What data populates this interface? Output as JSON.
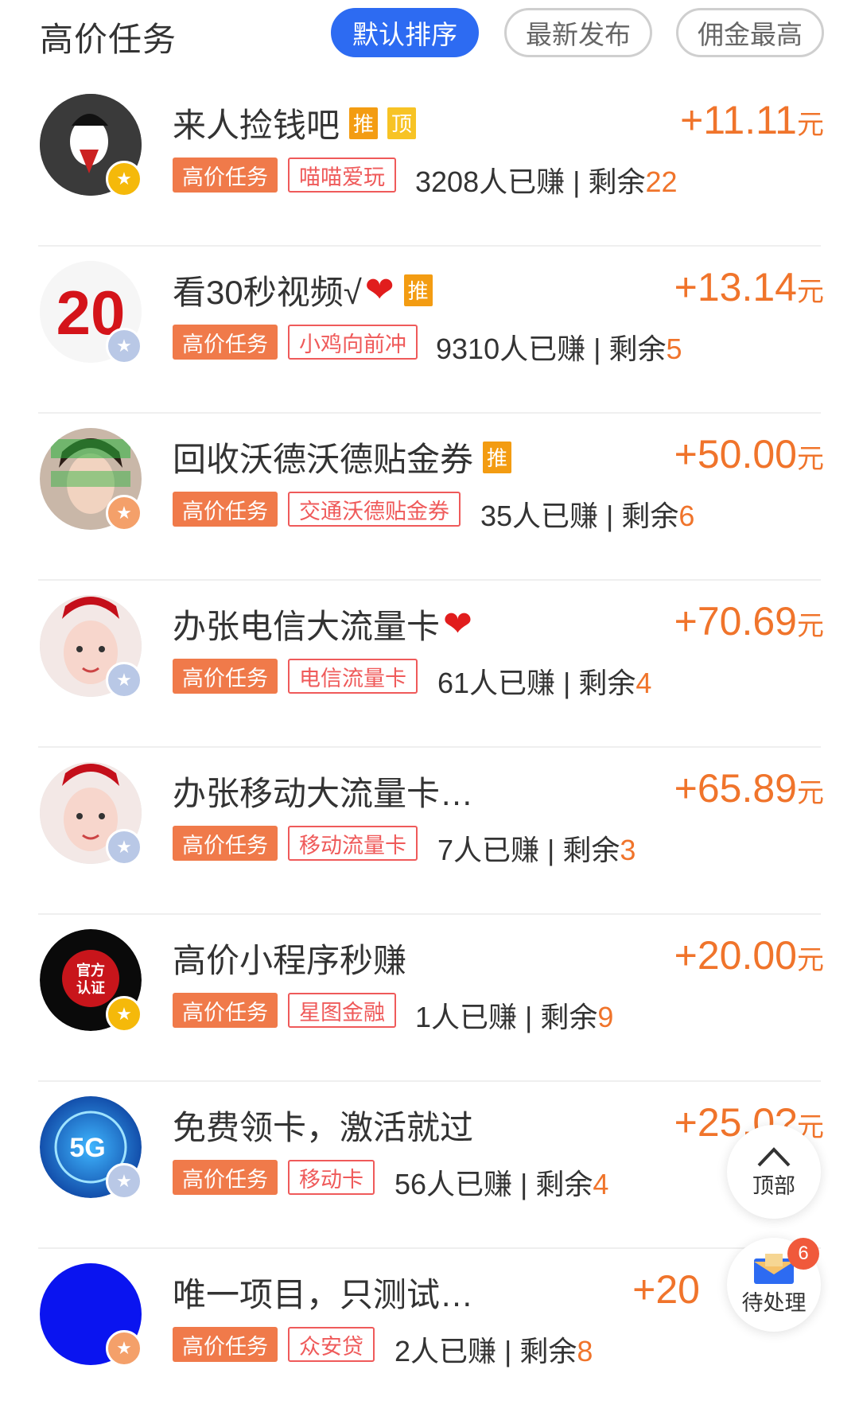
{
  "header": {
    "title": "高价任务",
    "sort_tabs": [
      {
        "label": "默认排序",
        "active": true
      },
      {
        "label": "最新发布",
        "active": false
      },
      {
        "label": "佣金最高",
        "active": false
      }
    ]
  },
  "colors": {
    "accent_blue": "#2d6bf2",
    "price_orange": "#f0742b",
    "chip_red": "#f07a4a",
    "tag_outline": "#ef5a5a"
  },
  "tasks": [
    {
      "title": "来人捡钱吧",
      "tags": [
        "推",
        "顶"
      ],
      "price": "+11.11",
      "unit": "元",
      "chip": "高价任务",
      "tag": "喵喵爱玩",
      "earned": "3208人已赚 | 剩余",
      "remain": "22"
    },
    {
      "title": "看30秒视频√",
      "heart": "❤",
      "tags": [
        "推"
      ],
      "price": "+13.14",
      "unit": "元",
      "chip": "高价任务",
      "tag": "小鸡向前冲",
      "earned": "9310人已赚 | 剩余",
      "remain": "5",
      "avatar_text": "20"
    },
    {
      "title": "回收沃德沃德贴金券",
      "tags": [
        "推"
      ],
      "price": "+50.00",
      "unit": "元",
      "chip": "高价任务",
      "tag": "交通沃德贴金券",
      "earned": "35人已赚 | 剩余",
      "remain": "6"
    },
    {
      "title": "办张电信大流量卡",
      "heart": "❤",
      "tags": [],
      "price": "+70.69",
      "unit": "元",
      "chip": "高价任务",
      "tag": "电信流量卡",
      "earned": "61人已赚 | 剩余",
      "remain": "4"
    },
    {
      "title": "办张移动大流量卡…",
      "tags": [],
      "price": "+65.89",
      "unit": "元",
      "chip": "高价任务",
      "tag": "移动流量卡",
      "earned": "7人已赚 | 剩余",
      "remain": "3"
    },
    {
      "title": "高价小程序秒赚",
      "tags": [],
      "price": "+20.00",
      "unit": "元",
      "chip": "高价任务",
      "tag": "星图金融",
      "earned": "1人已赚 | 剩余",
      "remain": "9",
      "avatar_text": "官方认证"
    },
    {
      "title": "免费领卡，激活就过",
      "tags": [],
      "price": "+25.0?",
      "unit": "元",
      "chip": "高价任务",
      "tag": "移动卡",
      "earned": "56人已赚 | 剩余",
      "remain": "4",
      "avatar_text": "5G"
    },
    {
      "title": "唯一项目，只测试…",
      "tags": [],
      "price": "+20",
      "unit": "元",
      "chip": "高价任务",
      "tag": "众安贷",
      "earned": "2人已赚 | 剩余",
      "remain": "8"
    }
  ],
  "fab_top": {
    "label": "顶部",
    "icon": "chevron-up-icon"
  },
  "fab_pending": {
    "label": "待处理",
    "count": "6",
    "icon": "mail-icon"
  }
}
